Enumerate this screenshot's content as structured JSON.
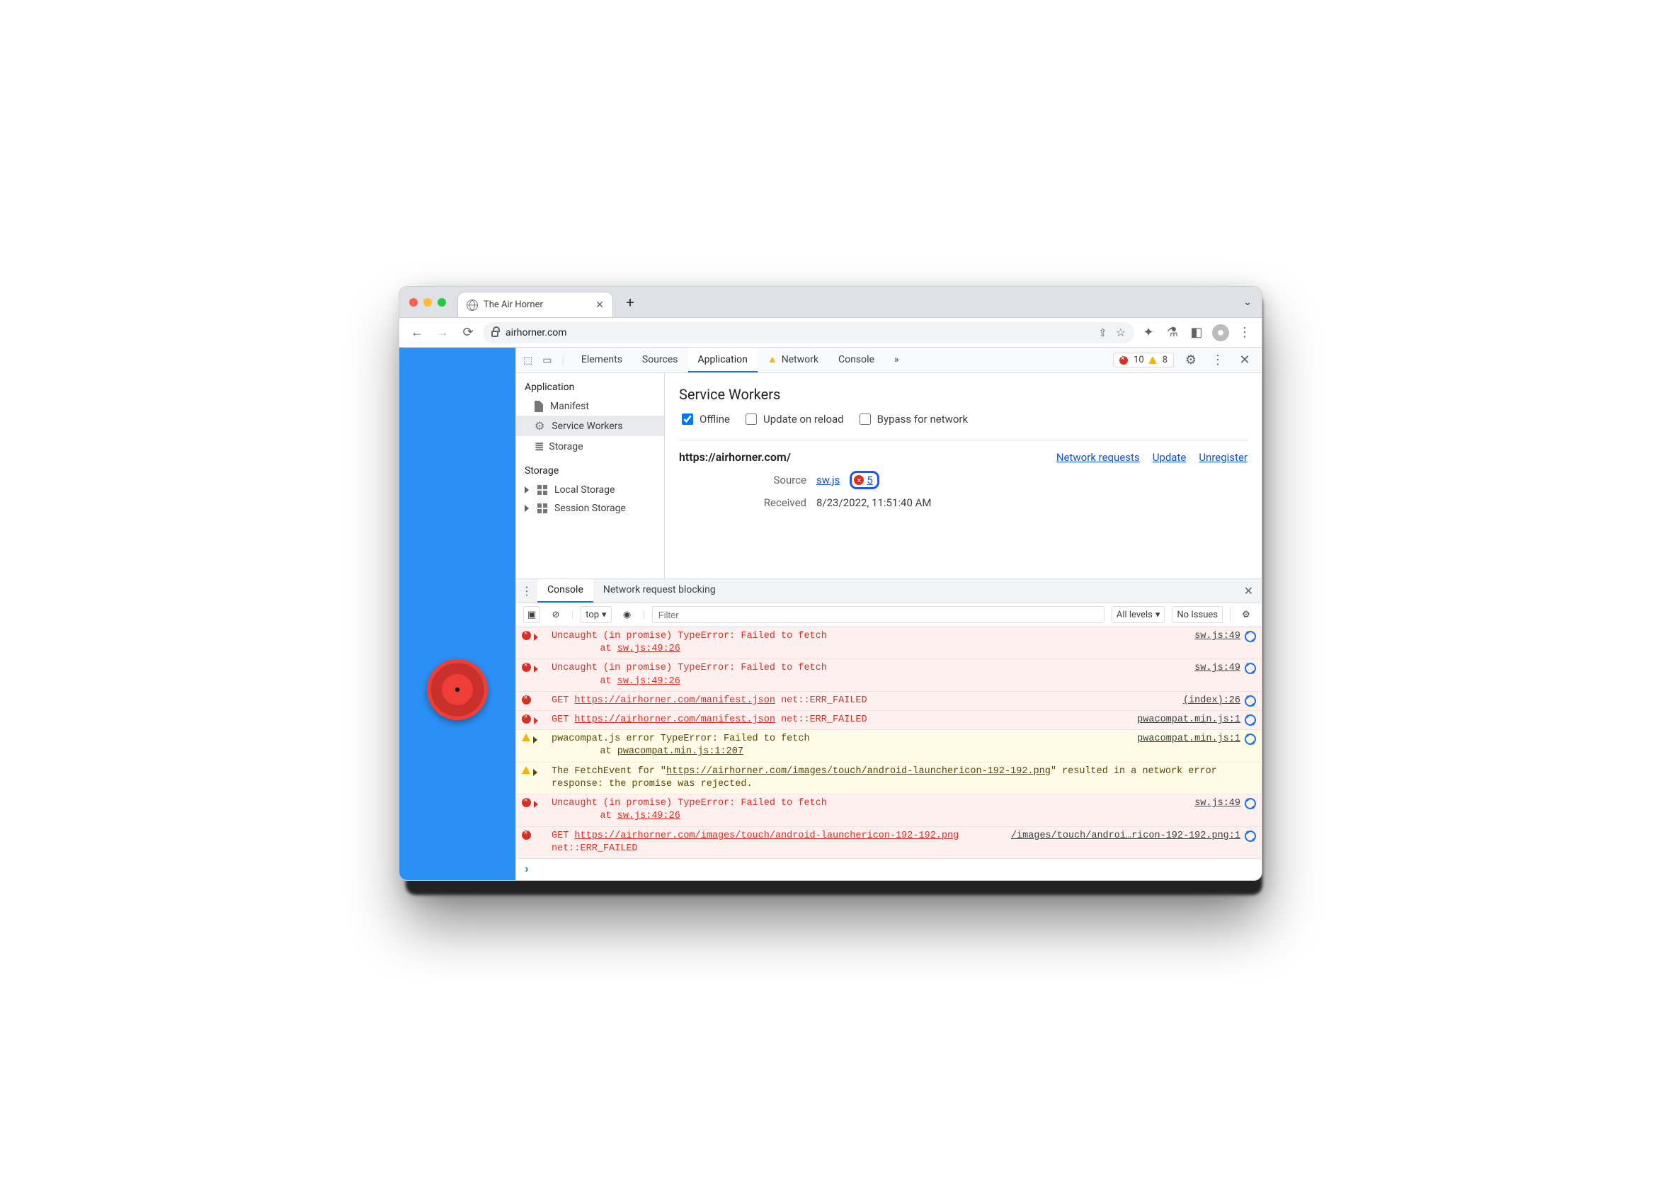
{
  "browser": {
    "tab_title": "The Air Horner",
    "url_display": "airhorner.com"
  },
  "devtools": {
    "tabs": {
      "elements": "Elements",
      "sources": "Sources",
      "application": "Application",
      "network": "Network",
      "console": "Console",
      "overflow": "»"
    },
    "counts": {
      "errors": "10",
      "warnings": "8"
    },
    "application": {
      "sidebar": {
        "heading_application": "Application",
        "manifest": "Manifest",
        "service_workers": "Service Workers",
        "storage_item": "Storage",
        "heading_storage": "Storage",
        "local_storage": "Local Storage",
        "session_storage": "Session Storage"
      },
      "main": {
        "title": "Service Workers",
        "checks": {
          "offline": "Offline",
          "update_on_reload": "Update on reload",
          "bypass_for_network": "Bypass for network"
        },
        "origin": "https://airhorner.com/",
        "links": {
          "network_requests": "Network requests",
          "update": "Update",
          "unregister": "Unregister"
        },
        "kv": {
          "source_label": "Source",
          "source_file": "sw.js",
          "error_count": "5",
          "received_label": "Received",
          "received_value": "8/23/2022, 11:51:40 AM"
        }
      }
    },
    "drawer": {
      "console_tab": "Console",
      "nrb_tab": "Network request blocking",
      "toolbar": {
        "context": "top",
        "filter_placeholder": "Filter",
        "levels": "All levels",
        "issues": "No Issues"
      }
    },
    "logs": [
      {
        "type": "error",
        "caret": true,
        "text": "Uncaught (in promise) TypeError: Failed to fetch",
        "at": "at sw.js:49:26",
        "right": "sw.js:49"
      },
      {
        "type": "error",
        "caret": true,
        "text": "Uncaught (in promise) TypeError: Failed to fetch",
        "at": "at sw.js:49:26",
        "right": "sw.js:49"
      },
      {
        "type": "error",
        "caret": false,
        "text": "GET https://airhorner.com/manifest.json net::ERR_FAILED",
        "right": "(index):26"
      },
      {
        "type": "error",
        "caret": true,
        "text": "GET https://airhorner.com/manifest.json net::ERR_FAILED",
        "right": "pwacompat.min.js:1"
      },
      {
        "type": "warning",
        "caret": true,
        "text": "pwacompat.js error TypeError: Failed to fetch",
        "at": "at pwacompat.min.js:1:207",
        "right": "pwacompat.min.js:1"
      },
      {
        "type": "warning",
        "caret": true,
        "text": "The FetchEvent for \"https://airhorner.com/images/touch/android-launchericon-192-192.png\" resulted in a network error response: the promise was rejected.",
        "right": ""
      },
      {
        "type": "error",
        "caret": true,
        "text": "Uncaught (in promise) TypeError: Failed to fetch",
        "at": "at sw.js:49:26",
        "right": "sw.js:49"
      },
      {
        "type": "error",
        "caret": false,
        "text": "GET https://airhorner.com/images/touch/android-launchericon-192-192.png net::ERR_FAILED",
        "right": "/images/touch/androi…ricon-192-192.png:1"
      }
    ]
  }
}
